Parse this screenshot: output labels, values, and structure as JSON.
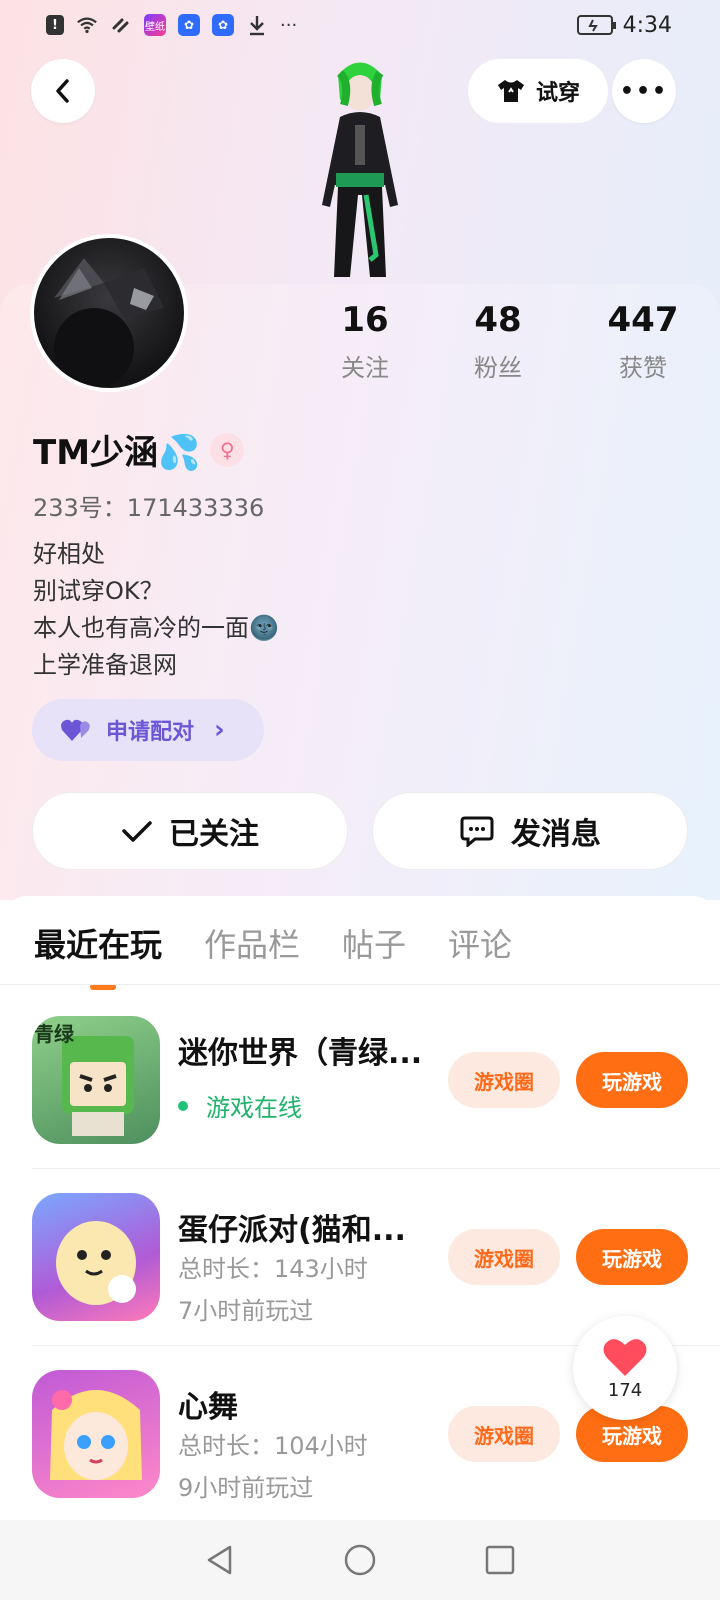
{
  "status_bar": {
    "time": "4:34",
    "app_icon_label": "壁纸",
    "more": "···"
  },
  "header": {
    "tryon_label": "试穿",
    "more_label": "•••"
  },
  "profile": {
    "stats": [
      {
        "value": "16",
        "label": "关注"
      },
      {
        "value": "48",
        "label": "粉丝"
      },
      {
        "value": "447",
        "label": "获赞"
      }
    ],
    "username": "TM少涵💦",
    "gender_symbol": "♀",
    "uid": "233号：171433336",
    "bio": [
      "好相处",
      "别试穿OK？",
      "本人也有高冷的一面🌚",
      "上学准备退网"
    ],
    "pair_label": "申请配对",
    "pair_chevron": "›"
  },
  "actions": {
    "followed_label": "已关注",
    "message_label": "发消息"
  },
  "tabs": [
    {
      "label": "最近在玩",
      "active": true
    },
    {
      "label": "作品栏",
      "active": false
    },
    {
      "label": "帖子",
      "active": false
    },
    {
      "label": "评论",
      "active": false
    }
  ],
  "games": [
    {
      "title": "迷你世界（青绿...",
      "online_text": "游戏在线",
      "icon_text": "青绿",
      "circle_label": "游戏圈",
      "play_label": "玩游戏"
    },
    {
      "title": "蛋仔派对(猫和...",
      "duration": "总时长：143小时",
      "last_played": "7小时前玩过",
      "circle_label": "游戏圈",
      "play_label": "玩游戏"
    },
    {
      "title": "心舞",
      "duration": "总时长：104小时",
      "last_played": "9小时前玩过",
      "circle_label": "游戏圈",
      "play_label": "玩游戏"
    }
  ],
  "like_float": {
    "count": "174"
  }
}
